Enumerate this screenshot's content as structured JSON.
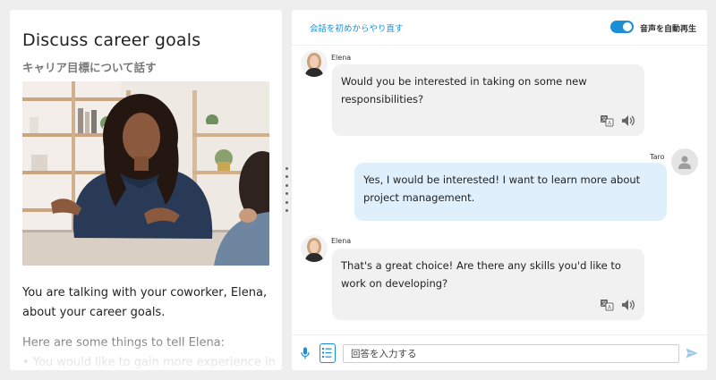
{
  "lesson": {
    "title": "Discuss career goals",
    "subtitle": "キャリア目標について話す",
    "description": "You are talking with your coworker, Elena, about your career goals.",
    "tell_header": "Here are some things to tell Elena:",
    "tell_items": [
      "• You would like to gain more experience in"
    ]
  },
  "chat_header": {
    "restart_label": "会話を初めからやり直す",
    "autoplay_label": "音声を自動再生",
    "autoplay_on": true
  },
  "messages": [
    {
      "speaker": "Elena",
      "role": "bot",
      "text": "Would you be interested in taking on some new responsibilities?"
    },
    {
      "speaker": "Taro",
      "role": "user",
      "text": "Yes, I would be interested! I want to learn more about project management."
    },
    {
      "speaker": "Elena",
      "role": "bot",
      "text": "That's a great choice! Are there any skills you'd like to work on developing?"
    }
  ],
  "input": {
    "placeholder": "回答を入力する",
    "value": ""
  },
  "icons": {
    "translate": "translate-icon",
    "speaker": "speaker-icon",
    "mic": "microphone-icon",
    "hints": "hint-list-icon",
    "send": "send-icon",
    "user": "user-avatar-icon"
  },
  "colors": {
    "accent": "#1a8fd6",
    "bot_bubble": "#f1f1f1",
    "user_bubble": "#dff0fc",
    "background": "#eeeeee"
  }
}
